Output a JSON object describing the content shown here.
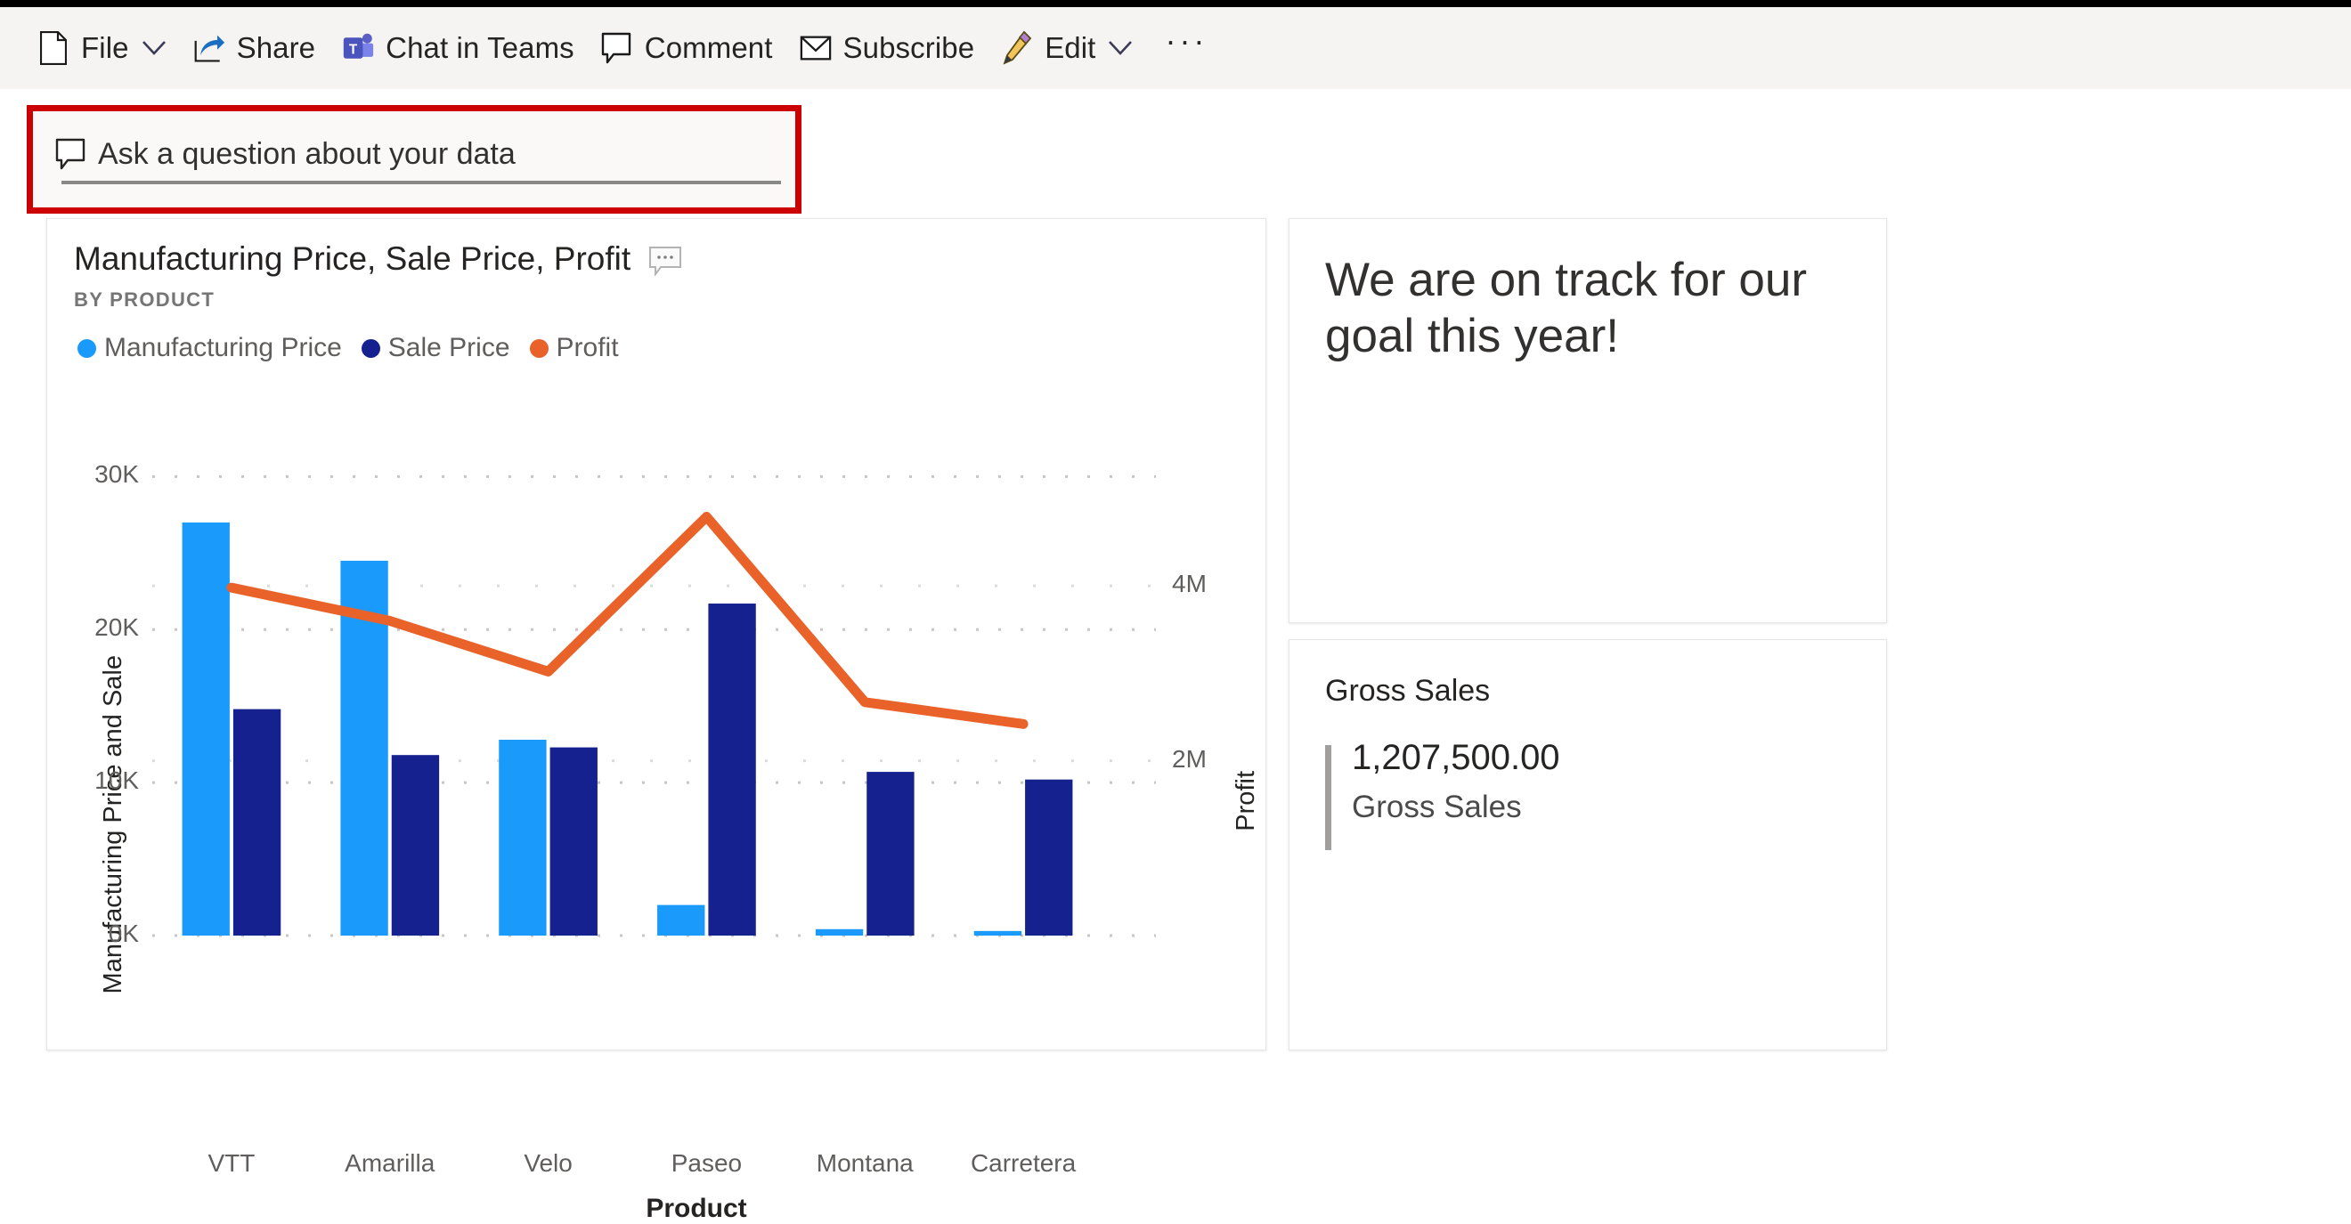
{
  "command_bar": {
    "items": [
      {
        "id": "file",
        "label": "File",
        "icon": "file-icon",
        "has_chevron": true
      },
      {
        "id": "share",
        "label": "Share",
        "icon": "share-icon",
        "has_chevron": false
      },
      {
        "id": "chat-in-teams",
        "label": "Chat in Teams",
        "icon": "teams-icon",
        "has_chevron": false
      },
      {
        "id": "comment",
        "label": "Comment",
        "icon": "comment-icon",
        "has_chevron": false
      },
      {
        "id": "subscribe",
        "label": "Subscribe",
        "icon": "envelope-icon",
        "has_chevron": false
      },
      {
        "id": "edit",
        "label": "Edit",
        "icon": "pencil-icon",
        "has_chevron": true
      }
    ],
    "more_label": "···"
  },
  "qna": {
    "placeholder": "Ask a question about your data",
    "icon": "qna-comment-icon",
    "highlight_color": "#cc0000"
  },
  "chart_card": {
    "title": "Manufacturing Price, Sale Price, Profit",
    "subtitle": "BY PRODUCT",
    "smart_narrative_icon": "smart-narrative-icon"
  },
  "text_card": {
    "body": "We are on track for our goal this year!"
  },
  "kpi_card": {
    "title": "Gross Sales",
    "value": "1,207,500.00",
    "sublabel": "Gross Sales"
  },
  "chart_data": {
    "type": "bar",
    "title": "Manufacturing Price, Sale Price, Profit",
    "subtitle": "BY PRODUCT",
    "xlabel": "Product",
    "ylabel": "Manufacturing Price and Sale",
    "y2label": "Profit",
    "categories": [
      "VTT",
      "Amarilla",
      "Velo",
      "Paseo",
      "Montana",
      "Carretera"
    ],
    "ylim": [
      0,
      32000
    ],
    "y_ticks": [
      "0K",
      "10K",
      "20K",
      "30K"
    ],
    "y_tick_values": [
      0,
      10000,
      20000,
      30000
    ],
    "y2lim": [
      0,
      5600000
    ],
    "y2_ticks": [
      "2M",
      "4M"
    ],
    "y2_tick_values": [
      2000000,
      4000000
    ],
    "grid": true,
    "legend_position": "top-left",
    "series": [
      {
        "name": "Manufacturing Price",
        "type": "bar",
        "axis": "left",
        "color": "#1a9bfc",
        "values": [
          27000,
          24500,
          12800,
          2000,
          420,
          300
        ]
      },
      {
        "name": "Sale Price",
        "type": "bar",
        "axis": "left",
        "color": "#15218f",
        "values": [
          14800,
          11800,
          12300,
          21700,
          10700,
          10200
        ]
      },
      {
        "name": "Profit",
        "type": "line",
        "axis": "right",
        "color": "#e8622a",
        "values": [
          3980000,
          3600000,
          3020000,
          4790000,
          2670000,
          2420000
        ]
      }
    ]
  }
}
